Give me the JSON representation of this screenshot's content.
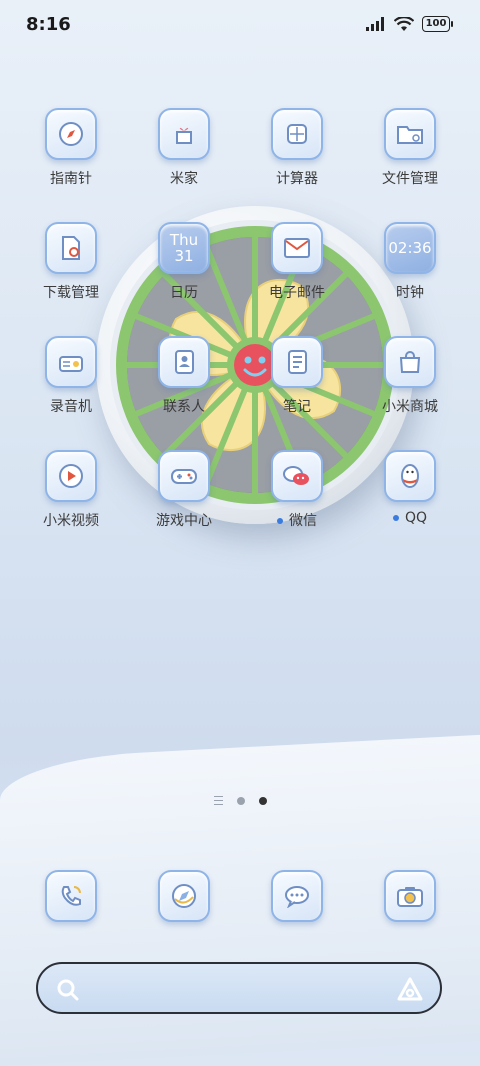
{
  "status_bar": {
    "time": "8:16",
    "battery": "100"
  },
  "widget": {
    "name": "fan-widget"
  },
  "apps": [
    {
      "label": "指南针",
      "icon": "compass-icon"
    },
    {
      "label": "米家",
      "icon": "gift-box-icon"
    },
    {
      "label": "计算器",
      "icon": "calculator-icon"
    },
    {
      "label": "文件管理",
      "icon": "folder-icon"
    },
    {
      "label": "下载管理",
      "icon": "download-file-icon"
    },
    {
      "label": "日历",
      "icon": "calendar-icon"
    },
    {
      "label": "电子邮件",
      "icon": "mail-icon"
    },
    {
      "label": "时钟",
      "icon": "clock-icon"
    },
    {
      "label": "录音机",
      "icon": "radio-icon"
    },
    {
      "label": "联系人",
      "icon": "contacts-icon"
    },
    {
      "label": "笔记",
      "icon": "notes-icon"
    },
    {
      "label": "小米商城",
      "icon": "shopping-bag-icon"
    },
    {
      "label": "小米视频",
      "icon": "play-icon"
    },
    {
      "label": "游戏中心",
      "icon": "gamepad-icon"
    },
    {
      "label": "微信",
      "icon": "wechat-icon",
      "badge": true
    },
    {
      "label": "QQ",
      "icon": "penguin-icon",
      "badge": true
    }
  ],
  "calendar": {
    "weekday": "Thu",
    "day": "31"
  },
  "clock": {
    "time": "02:36"
  },
  "pager": {
    "pages": 2,
    "active": 2
  },
  "dock": [
    {
      "icon": "phone-icon"
    },
    {
      "icon": "browser-icon"
    },
    {
      "icon": "messages-icon"
    },
    {
      "icon": "camera-icon"
    }
  ],
  "colors": {
    "icon_border": "#8fb4e8",
    "badge": "#3a7be0",
    "fan_frame": "#8cc66f",
    "fan_blade": "#f7e7a5"
  }
}
